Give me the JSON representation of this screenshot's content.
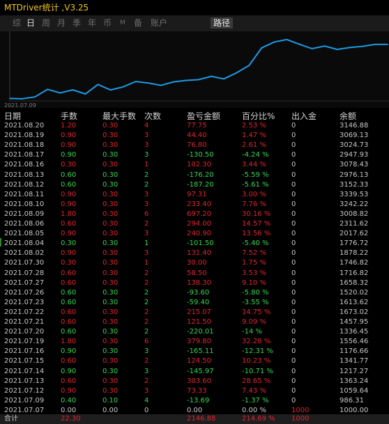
{
  "window": {
    "title": "MTDriver统计 ,V3.25"
  },
  "tabs": [
    {
      "label": "综",
      "state": "inactive"
    },
    {
      "label": "日",
      "state": "active"
    },
    {
      "label": "周",
      "state": "inactive"
    },
    {
      "label": "月",
      "state": "inactive"
    },
    {
      "label": "季",
      "state": "inactive"
    },
    {
      "label": "年",
      "state": "inactive"
    },
    {
      "label": "币",
      "state": "inactive"
    },
    {
      "label": "M",
      "state": "inactive"
    },
    {
      "label": "备",
      "state": "inactive"
    },
    {
      "label": "账户",
      "state": "inactive"
    },
    {
      "label": "路径",
      "state": "selected"
    }
  ],
  "chart": {
    "start_label": "2021.07.09",
    "line_color": "#1e9be6"
  },
  "chart_data": {
    "type": "line",
    "x": [
      "2021.07.07",
      "2021.07.09",
      "2021.07.12",
      "2021.07.13",
      "2021.07.14",
      "2021.07.15",
      "2021.07.16",
      "2021.07.19",
      "2021.07.20",
      "2021.07.21",
      "2021.07.22",
      "2021.07.23",
      "2021.07.26",
      "2021.07.27",
      "2021.07.28",
      "2021.07.29",
      "2021.07.30",
      "2021.08.02",
      "2021.08.04",
      "2021.08.05",
      "2021.08.06",
      "2021.08.09",
      "2021.08.10",
      "2021.08.11",
      "2021.08.12",
      "2021.08.13",
      "2021.08.16",
      "2021.08.17",
      "2021.08.18",
      "2021.08.19",
      "2021.08.20"
    ],
    "values": [
      1000.0,
      986.31,
      1059.64,
      1363.24,
      1217.27,
      1341.77,
      1176.66,
      1556.46,
      1336.45,
      1457.95,
      1673.02,
      1613.62,
      1520.02,
      1658.32,
      1716.82,
      1746.82,
      1878.22,
      1776.72,
      2017.62,
      2311.62,
      3008.82,
      3242.22,
      3339.53,
      3152.33,
      2976.13,
      3078.43,
      2947.93,
      3024.73,
      3069.13,
      3146.88,
      3146.88
    ],
    "ylim": [
      900,
      3500
    ]
  },
  "table": {
    "headers": [
      "日期",
      "手数",
      "最大手数",
      "次数",
      "盈亏金额",
      "百分比%",
      "出入金",
      "余额"
    ],
    "rows": [
      {
        "date": "2021.08.20",
        "lots": "1.20",
        "max_lots": "0.30",
        "count": "4",
        "pnl": "77.75",
        "pct": "2.53 %",
        "flow": "0",
        "balance": "3146.88",
        "dir": "red"
      },
      {
        "date": "2021.08.19",
        "lots": "0.90",
        "max_lots": "0.30",
        "count": "3",
        "pnl": "44.40",
        "pct": "1.47 %",
        "flow": "0",
        "balance": "3069.13",
        "dir": "red"
      },
      {
        "date": "2021.08.18",
        "lots": "0.90",
        "max_lots": "0.30",
        "count": "3",
        "pnl": "76.80",
        "pct": "2.61 %",
        "flow": "0",
        "balance": "3024.73",
        "dir": "red"
      },
      {
        "date": "2021.08.17",
        "lots": "0.90",
        "max_lots": "0.30",
        "count": "3",
        "pnl": "-130.50",
        "pct": "-4.24 %",
        "flow": "0",
        "balance": "2947.93",
        "dir": "green"
      },
      {
        "date": "2021.08.16",
        "lots": "0.30",
        "max_lots": "0.30",
        "count": "1",
        "pnl": "102.30",
        "pct": "3.44 %",
        "flow": "0",
        "balance": "3078.43",
        "dir": "red"
      },
      {
        "date": "2021.08.13",
        "lots": "0.60",
        "max_lots": "0.30",
        "count": "2",
        "pnl": "-176.20",
        "pct": "-5.59 %",
        "flow": "0",
        "balance": "2976.13",
        "dir": "green"
      },
      {
        "date": "2021.08.12",
        "lots": "0.60",
        "max_lots": "0.30",
        "count": "2",
        "pnl": "-187.20",
        "pct": "-5.61 %",
        "flow": "0",
        "balance": "3152.33",
        "dir": "green"
      },
      {
        "date": "2021.08.11",
        "lots": "0.90",
        "max_lots": "0.30",
        "count": "3",
        "pnl": "97.31",
        "pct": "3.00 %",
        "flow": "0",
        "balance": "3339.53",
        "dir": "red"
      },
      {
        "date": "2021.08.10",
        "lots": "0.90",
        "max_lots": "0.30",
        "count": "3",
        "pnl": "233.40",
        "pct": "7.76 %",
        "flow": "0",
        "balance": "3242.22",
        "dir": "red"
      },
      {
        "date": "2021.08.09",
        "lots": "1.80",
        "max_lots": "0.30",
        "count": "6",
        "pnl": "697.20",
        "pct": "30.16 %",
        "flow": "0",
        "balance": "3008.82",
        "dir": "red"
      },
      {
        "date": "2021.08.06",
        "lots": "0.60",
        "max_lots": "0.30",
        "count": "2",
        "pnl": "294.00",
        "pct": "14.57 %",
        "flow": "0",
        "balance": "2311.62",
        "dir": "red"
      },
      {
        "date": "2021.08.05",
        "lots": "0.90",
        "max_lots": "0.30",
        "count": "3",
        "pnl": "240.90",
        "pct": "13.56 %",
        "flow": "0",
        "balance": "2017.62",
        "dir": "red"
      },
      {
        "date": "2021.08.04",
        "lots": "0.30",
        "max_lots": "0.30",
        "count": "1",
        "pnl": "-101.50",
        "pct": "-5.40 %",
        "flow": "0",
        "balance": "1776.72",
        "dir": "green"
      },
      {
        "date": "2021.08.02",
        "lots": "0.90",
        "max_lots": "0.30",
        "count": "3",
        "pnl": "131.40",
        "pct": "7.52 %",
        "flow": "0",
        "balance": "1878.22",
        "dir": "red"
      },
      {
        "date": "2021.07.30",
        "lots": "0.30",
        "max_lots": "0.30",
        "count": "1",
        "pnl": "30.00",
        "pct": "1.75 %",
        "flow": "0",
        "balance": "1746.82",
        "dir": "red"
      },
      {
        "date": "2021.07.28",
        "lots": "0.60",
        "max_lots": "0.30",
        "count": "2",
        "pnl": "58.50",
        "pct": "3.53 %",
        "flow": "0",
        "balance": "1716.82",
        "dir": "red"
      },
      {
        "date": "2021.07.27",
        "lots": "0.60",
        "max_lots": "0.30",
        "count": "2",
        "pnl": "138.30",
        "pct": "9.10 %",
        "flow": "0",
        "balance": "1658.32",
        "dir": "red"
      },
      {
        "date": "2021.07.26",
        "lots": "0.60",
        "max_lots": "0.30",
        "count": "2",
        "pnl": "-93.60",
        "pct": "-5.80 %",
        "flow": "0",
        "balance": "1520.02",
        "dir": "green"
      },
      {
        "date": "2021.07.23",
        "lots": "0.60",
        "max_lots": "0.30",
        "count": "2",
        "pnl": "-59.40",
        "pct": "-3.55 %",
        "flow": "0",
        "balance": "1613.62",
        "dir": "green"
      },
      {
        "date": "2021.07.22",
        "lots": "0.60",
        "max_lots": "0.30",
        "count": "2",
        "pnl": "215.07",
        "pct": "14.75 %",
        "flow": "0",
        "balance": "1673.02",
        "dir": "red"
      },
      {
        "date": "2021.07.21",
        "lots": "0.60",
        "max_lots": "0.30",
        "count": "2",
        "pnl": "121.50",
        "pct": "9.09 %",
        "flow": "0",
        "balance": "1457.95",
        "dir": "red"
      },
      {
        "date": "2021.07.20",
        "lots": "0.60",
        "max_lots": "0.30",
        "count": "2",
        "pnl": "-220.01",
        "pct": "-14 %",
        "flow": "0",
        "balance": "1336.45",
        "dir": "green"
      },
      {
        "date": "2021.07.19",
        "lots": "1.80",
        "max_lots": "0.30",
        "count": "6",
        "pnl": "379.80",
        "pct": "32.28 %",
        "flow": "0",
        "balance": "1556.46",
        "dir": "red"
      },
      {
        "date": "2021.07.16",
        "lots": "0.90",
        "max_lots": "0.30",
        "count": "3",
        "pnl": "-165.11",
        "pct": "-12.31 %",
        "flow": "0",
        "balance": "1176.66",
        "dir": "green"
      },
      {
        "date": "2021.07.15",
        "lots": "0.60",
        "max_lots": "0.30",
        "count": "2",
        "pnl": "124.50",
        "pct": "10.23 %",
        "flow": "0",
        "balance": "1341.77",
        "dir": "red"
      },
      {
        "date": "2021.07.14",
        "lots": "0.90",
        "max_lots": "0.30",
        "count": "3",
        "pnl": "-145.97",
        "pct": "-10.71 %",
        "flow": "0",
        "balance": "1217.27",
        "dir": "green"
      },
      {
        "date": "2021.07.13",
        "lots": "0.60",
        "max_lots": "0.30",
        "count": "2",
        "pnl": "303.60",
        "pct": "28.65 %",
        "flow": "0",
        "balance": "1363.24",
        "dir": "red"
      },
      {
        "date": "2021.07.12",
        "lots": "0.90",
        "max_lots": "0.30",
        "count": "3",
        "pnl": "73.33",
        "pct": "7.43 %",
        "flow": "0",
        "balance": "1059.64",
        "dir": "red"
      },
      {
        "date": "2021.07.09",
        "lots": "0.40",
        "max_lots": "0.10",
        "count": "4",
        "pnl": "-13.69",
        "pct": "-1.37 %",
        "flow": "0",
        "balance": "986.31",
        "dir": "green"
      },
      {
        "date": "2021.07.07",
        "lots": "0.00",
        "max_lots": "0.00",
        "count": "0",
        "pnl": "0.00",
        "pct": "0.00 %",
        "flow": "1000",
        "balance": "1000.00",
        "dir": "neutral"
      }
    ],
    "footer": {
      "label": "合计",
      "lots": "22.30",
      "pnl": "2146.88",
      "pct": "214.69 %",
      "flow": "1000"
    }
  },
  "colors": {
    "profit": "#e0242e",
    "loss": "#33d650",
    "title": "#f0c814"
  }
}
